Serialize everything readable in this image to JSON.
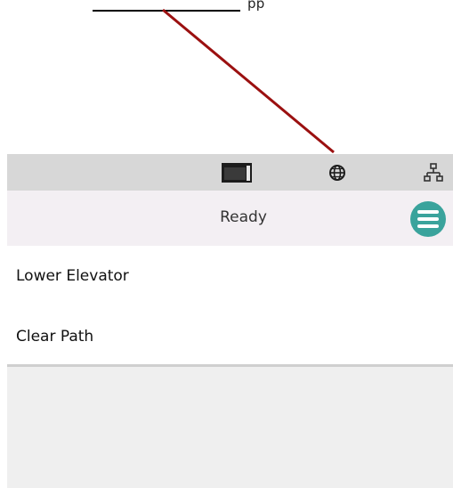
{
  "annotation": {
    "partial_text": "pp"
  },
  "toolbar": {
    "icons": [
      "window-icon",
      "globe-icon",
      "network-icon"
    ]
  },
  "status": {
    "text": "Ready"
  },
  "actions": [
    {
      "label": "Lower Elevator"
    },
    {
      "label": "Clear Path"
    }
  ],
  "colors": {
    "accent": "#3aa39c",
    "toolbar_bg": "#d7d7d7",
    "status_bg": "#f3eff3",
    "panel_bg": "#efefef",
    "pointer_line": "#9b1010"
  }
}
